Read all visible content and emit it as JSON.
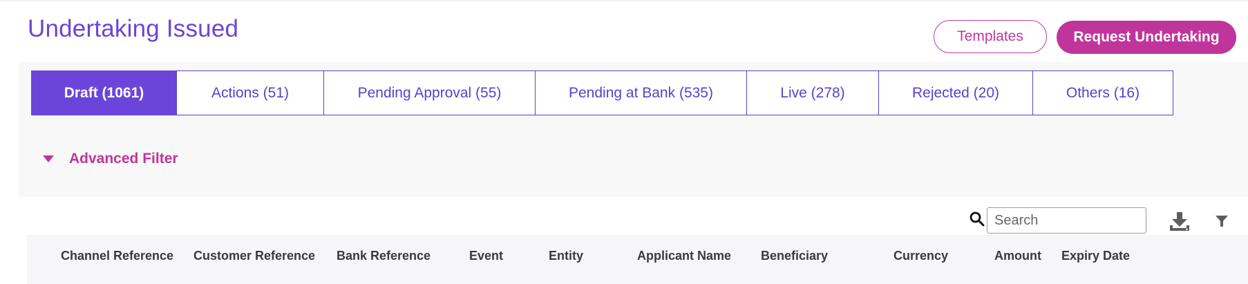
{
  "page": {
    "title": "Undertaking Issued"
  },
  "header_actions": {
    "templates_label": "Templates",
    "request_label": "Request Undertaking"
  },
  "tabs": [
    {
      "label": "Draft (1061)",
      "active": true
    },
    {
      "label": "Actions (51)",
      "active": false
    },
    {
      "label": "Pending Approval (55)",
      "active": false
    },
    {
      "label": "Pending at Bank (535)",
      "active": false
    },
    {
      "label": "Live (278)",
      "active": false
    },
    {
      "label": "Rejected (20)",
      "active": false
    },
    {
      "label": "Others (16)",
      "active": false
    }
  ],
  "advanced_filter": {
    "label": "Advanced Filter",
    "icon": "caret-down-icon"
  },
  "search": {
    "placeholder": "Search",
    "value": "",
    "icon": "search-icon"
  },
  "toolbar_icons": {
    "download": "download-icon",
    "filter": "filter-icon"
  },
  "table": {
    "columns": [
      "Channel Reference",
      "Customer Reference",
      "Bank Reference",
      "Event",
      "Entity",
      "Applicant Name",
      "Beneficiary",
      "Currency",
      "Amount",
      "Expiry Date"
    ]
  },
  "colors": {
    "title": "#6a45d6",
    "accent_magenta": "#c0359c",
    "tab_active_bg": "#6b45d9",
    "tab_border": "#5a3fd0",
    "panel_bg": "#f8f8f8",
    "table_header_bg": "#f6f6f9"
  }
}
